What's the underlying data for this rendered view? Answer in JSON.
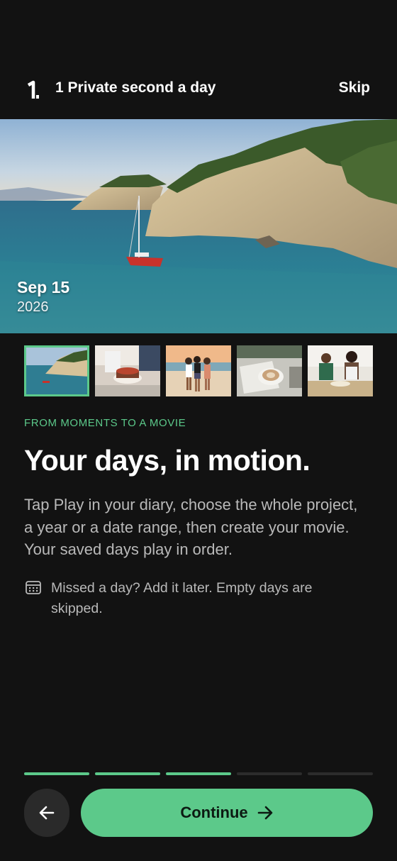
{
  "header": {
    "app_title": "1 Private second a day",
    "skip_label": "Skip"
  },
  "hero": {
    "date": "Sep 15",
    "year": "2026"
  },
  "thumbnails": [
    {
      "name": "coastline",
      "selected": true
    },
    {
      "name": "birthday-cake",
      "selected": false
    },
    {
      "name": "beach-walk",
      "selected": false
    },
    {
      "name": "coffee-journal",
      "selected": false
    },
    {
      "name": "cooking-together",
      "selected": false
    }
  ],
  "content": {
    "eyebrow": "FROM MOMENTS TO A MOVIE",
    "headline": "Your days, in motion.",
    "body": "Tap Play in your diary, choose the whole project, a year or a date range, then create your movie. Your saved days play in order.",
    "note_icon": "calendar-icon",
    "note": "Missed a day? Add it later. Empty days are skipped."
  },
  "progress": {
    "total_steps": 5,
    "completed_steps": 3
  },
  "footer": {
    "back_icon": "arrow-left-icon",
    "continue_label": "Continue",
    "continue_icon": "arrow-right-icon"
  },
  "colors": {
    "background": "#121212",
    "accent": "#5cc98a",
    "body_text": "#b9b9b9"
  }
}
